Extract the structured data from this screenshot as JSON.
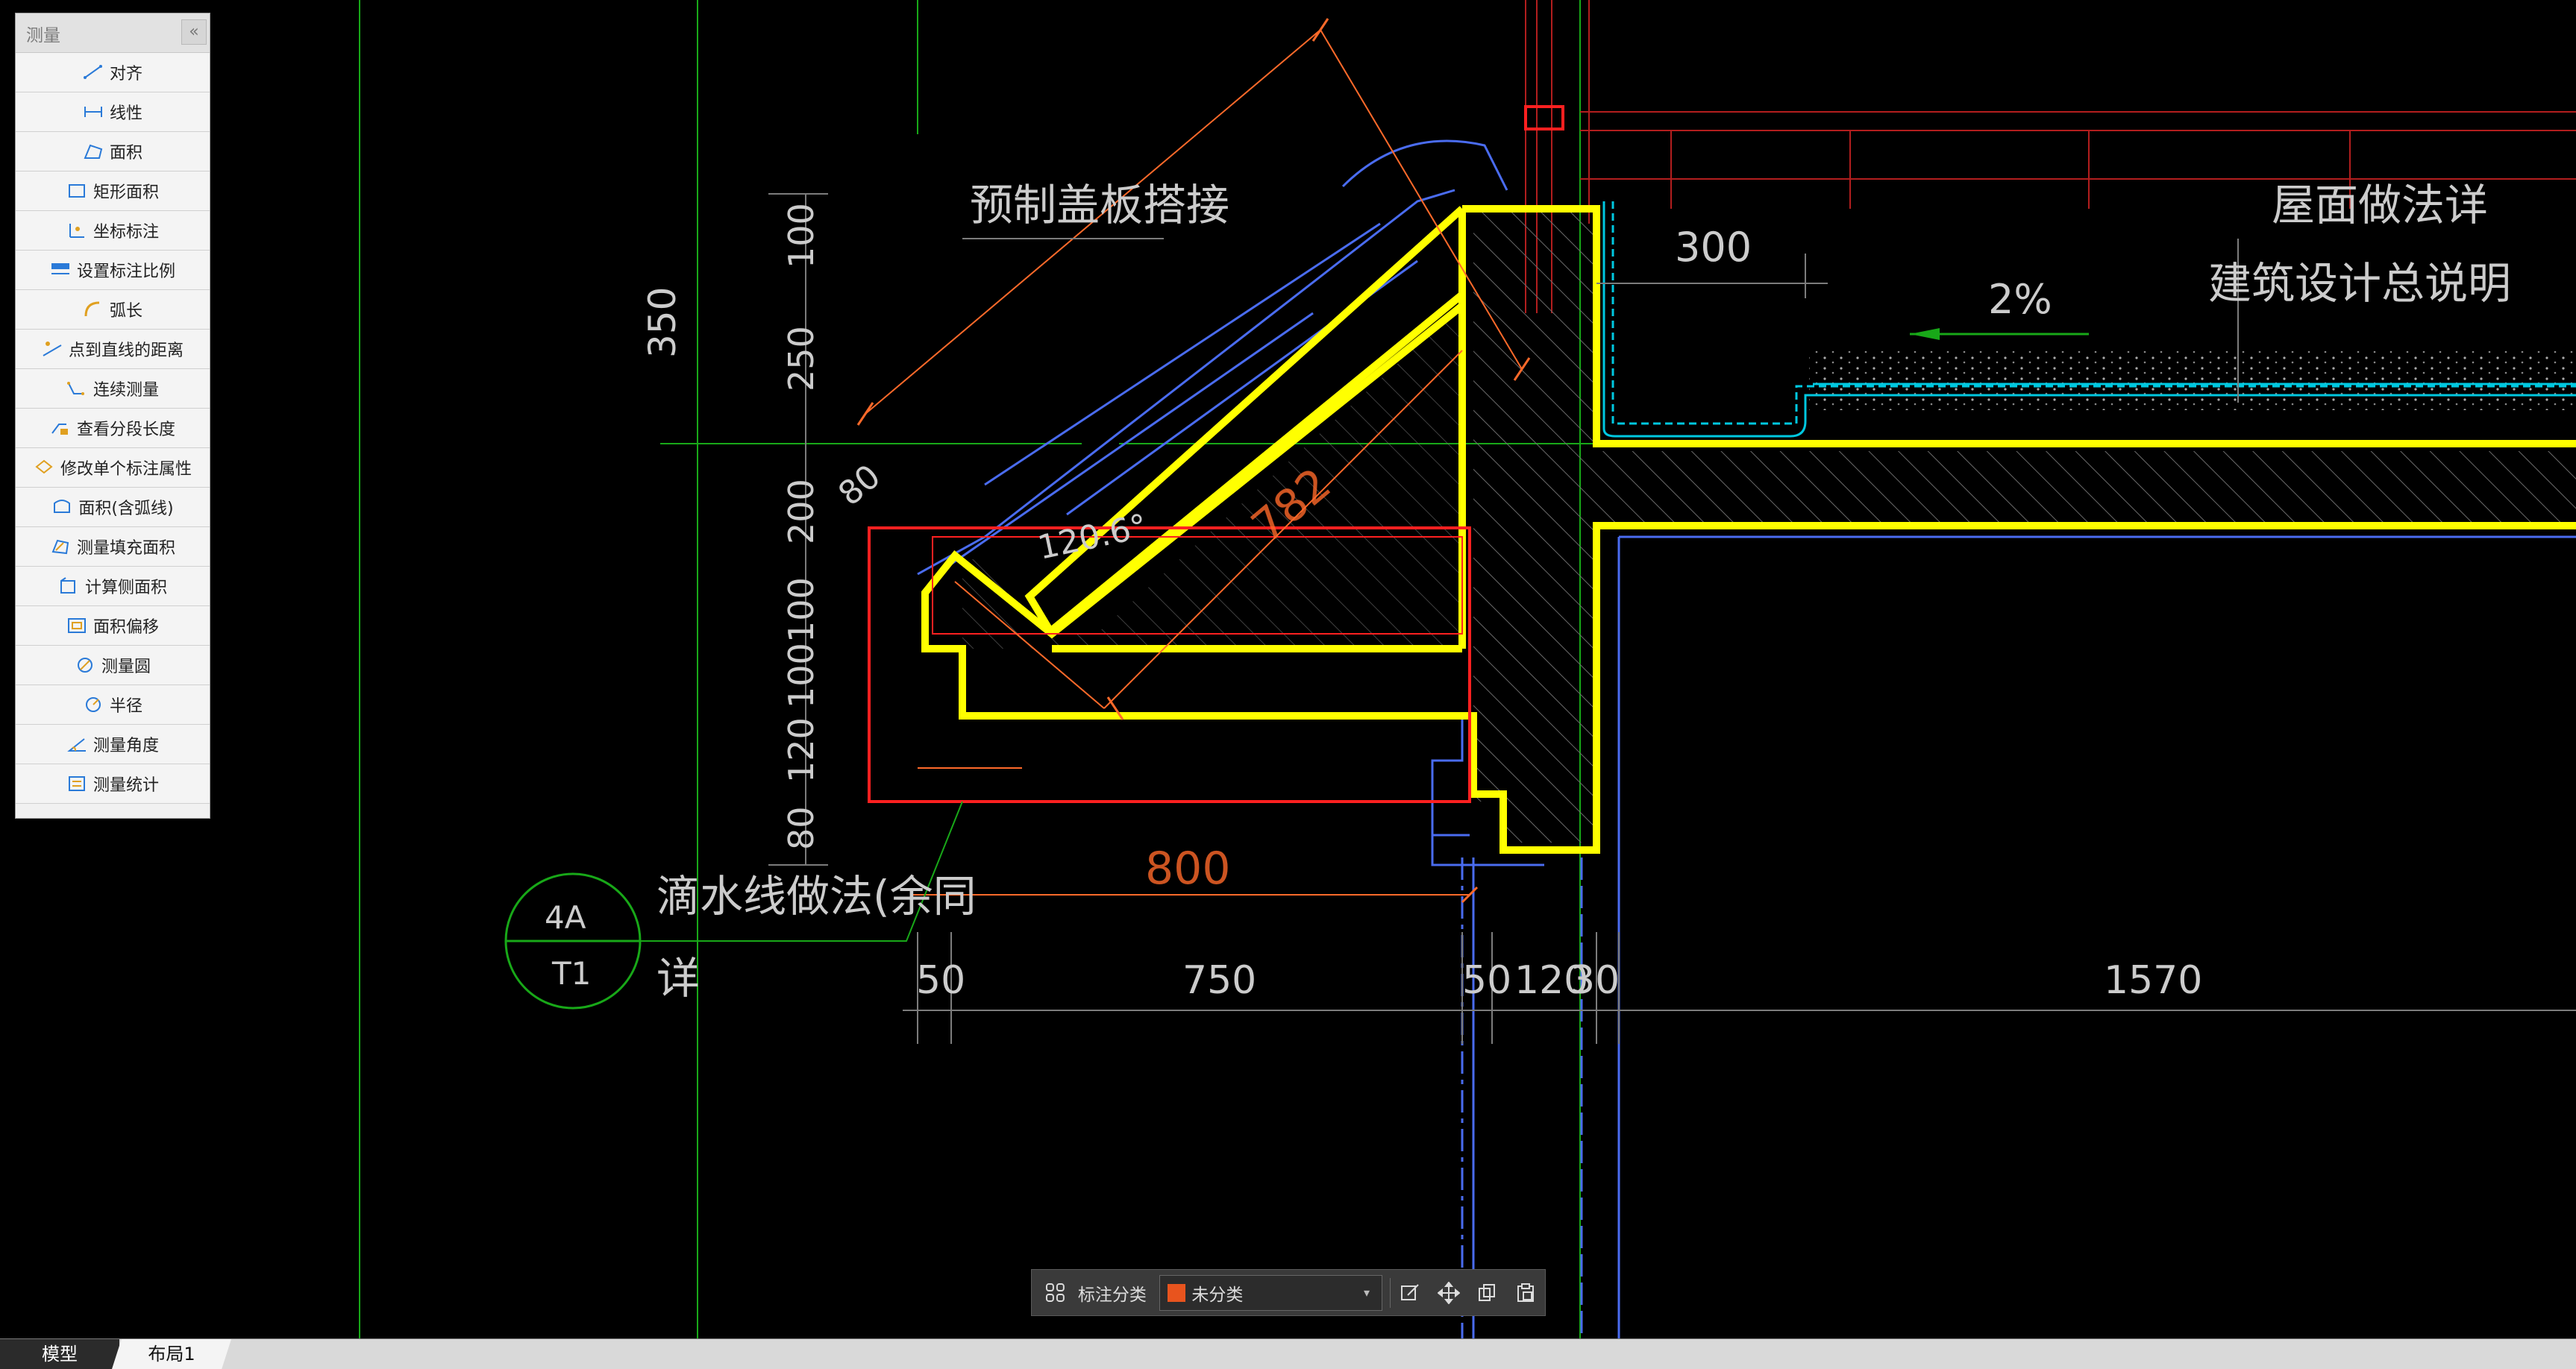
{
  "palette": {
    "title": "测量",
    "close_glyph": "«",
    "items": [
      {
        "label": "对齐",
        "icon": "align-dimension-icon"
      },
      {
        "label": "线性",
        "icon": "linear-dimension-icon"
      },
      {
        "label": "面积",
        "icon": "area-icon"
      },
      {
        "label": "矩形面积",
        "icon": "rect-area-icon"
      },
      {
        "label": "坐标标注",
        "icon": "coordinate-icon"
      },
      {
        "label": "设置标注比例",
        "icon": "scale-icon"
      },
      {
        "label": "弧长",
        "icon": "arc-length-icon"
      },
      {
        "label": "点到直线的距离",
        "icon": "point-line-distance-icon"
      },
      {
        "label": "连续测量",
        "icon": "continuous-measure-icon"
      },
      {
        "label": "查看分段长度",
        "icon": "segment-length-icon"
      },
      {
        "label": "修改单个标注属性",
        "icon": "edit-dimension-icon"
      },
      {
        "label": "面积(含弧线)",
        "icon": "arc-area-icon"
      },
      {
        "label": "测量填充面积",
        "icon": "hatch-area-icon"
      },
      {
        "label": "计算侧面积",
        "icon": "side-area-icon"
      },
      {
        "label": "面积偏移",
        "icon": "area-offset-icon"
      },
      {
        "label": "测量圆",
        "icon": "circle-measure-icon"
      },
      {
        "label": "半径",
        "icon": "radius-icon"
      },
      {
        "label": "测量角度",
        "icon": "angle-measure-icon"
      },
      {
        "label": "测量统计",
        "icon": "measure-stats-icon"
      }
    ]
  },
  "drawing": {
    "labels": {
      "prefab_cover": "预制盖板搭接",
      "roof_method_1": "屋面做法详",
      "roof_method_2": "建筑设计总说明",
      "slope": "2%",
      "drip_1": "滴水线做法(余同",
      "drip_2": "详",
      "tag_top": "4A",
      "tag_bottom": "T1",
      "angle": "120.6°",
      "diag_782": "782",
      "dim_80_diag": "80",
      "dim_300": "300",
      "dim_800": "800"
    },
    "vertical_dims": [
      "100",
      "250",
      "200",
      "100",
      "100",
      "120",
      "80"
    ],
    "dim_350": "350",
    "bottom_dims": [
      "50",
      "750",
      "50",
      "120",
      "30",
      "1570"
    ],
    "colors": {
      "highlight": "#ffff00",
      "selection": "#ff2020",
      "dimension": "#ff6a2a",
      "annotation_text": "#cccccc",
      "structure": "#4a6cf0",
      "waterproof": "#00c8e0",
      "grid": "#18a818"
    }
  },
  "annotation_toolbar": {
    "grid_icon": "category-grid-icon",
    "label": "标注分类",
    "selected": "未分类",
    "swatch_color": "#e8541e",
    "tools": [
      "edit-icon",
      "move-icon",
      "copy-icon",
      "paste-icon"
    ]
  },
  "tabs": {
    "model": "模型",
    "layout1": "布局1"
  }
}
